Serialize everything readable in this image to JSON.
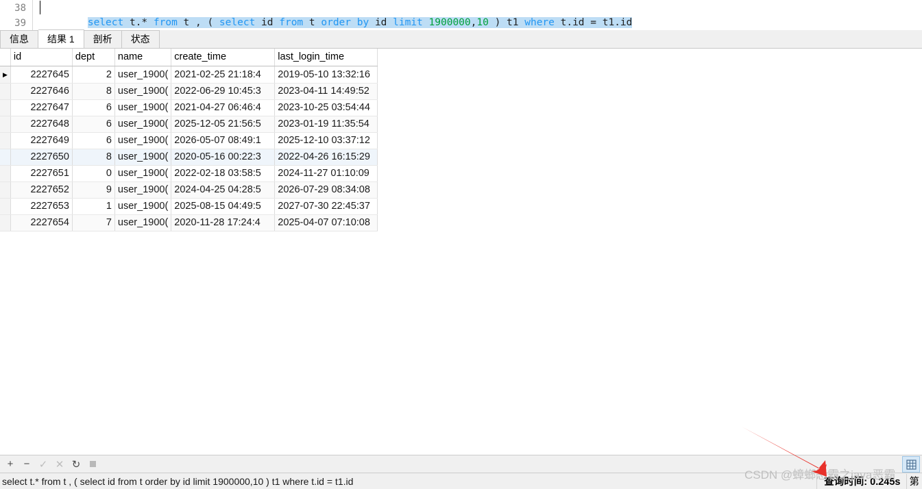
{
  "editor": {
    "line_numbers": [
      "38",
      "39"
    ],
    "sql_tokens": [
      {
        "t": "select",
        "k": "kw"
      },
      {
        "t": " t.* ",
        "k": "plain"
      },
      {
        "t": "from",
        "k": "kw"
      },
      {
        "t": " t , ( ",
        "k": "plain"
      },
      {
        "t": "select",
        "k": "kw"
      },
      {
        "t": " id ",
        "k": "plain"
      },
      {
        "t": "from",
        "k": "kw"
      },
      {
        "t": " t ",
        "k": "plain"
      },
      {
        "t": "order",
        "k": "kw"
      },
      {
        "t": " ",
        "k": "plain"
      },
      {
        "t": "by",
        "k": "kw"
      },
      {
        "t": " id ",
        "k": "plain"
      },
      {
        "t": "limit",
        "k": "kw"
      },
      {
        "t": " ",
        "k": "plain"
      },
      {
        "t": "1900000",
        "k": "num"
      },
      {
        "t": ",",
        "k": "plain"
      },
      {
        "t": "10",
        "k": "num"
      },
      {
        "t": " ) t1 ",
        "k": "plain"
      },
      {
        "t": "where",
        "k": "kw"
      },
      {
        "t": " t.id = t1.id",
        "k": "plain"
      }
    ],
    "colors": {
      "keyword": "#2196f3",
      "number": "#00a03a",
      "selection": "#bdddf5"
    }
  },
  "tabs": [
    {
      "label": "信息",
      "active": false
    },
    {
      "label": "结果 1",
      "active": true
    },
    {
      "label": "剖析",
      "active": false
    },
    {
      "label": "状态",
      "active": false
    }
  ],
  "table": {
    "columns": [
      "id",
      "dept",
      "name",
      "create_time",
      "last_login_time"
    ],
    "rows": [
      {
        "id": "2227645",
        "dept": "2",
        "name": "user_1900(",
        "create_time": "2021-02-25 21:18:4",
        "last_login_time": "2019-05-10 13:32:16",
        "current": true
      },
      {
        "id": "2227646",
        "dept": "8",
        "name": "user_1900(",
        "create_time": "2022-06-29 10:45:3",
        "last_login_time": "2023-04-11 14:49:52",
        "current": false
      },
      {
        "id": "2227647",
        "dept": "6",
        "name": "user_1900(",
        "create_time": "2021-04-27 06:46:4",
        "last_login_time": "2023-10-25 03:54:44",
        "current": false
      },
      {
        "id": "2227648",
        "dept": "6",
        "name": "user_1900(",
        "create_time": "2025-12-05 21:56:5",
        "last_login_time": "2023-01-19 11:35:54",
        "current": false
      },
      {
        "id": "2227649",
        "dept": "6",
        "name": "user_1900(",
        "create_time": "2026-05-07 08:49:1",
        "last_login_time": "2025-12-10 03:37:12",
        "current": false
      },
      {
        "id": "2227650",
        "dept": "8",
        "name": "user_1900(",
        "create_time": "2020-05-16 00:22:3",
        "last_login_time": "2022-04-26 16:15:29",
        "current": false
      },
      {
        "id": "2227651",
        "dept": "0",
        "name": "user_1900(",
        "create_time": "2022-02-18 03:58:5",
        "last_login_time": "2024-11-27 01:10:09",
        "current": false
      },
      {
        "id": "2227652",
        "dept": "9",
        "name": "user_1900(",
        "create_time": "2024-04-25 04:28:5",
        "last_login_time": "2026-07-29 08:34:08",
        "current": false
      },
      {
        "id": "2227653",
        "dept": "1",
        "name": "user_1900(",
        "create_time": "2025-08-15 04:49:5",
        "last_login_time": "2027-07-30 22:45:37",
        "current": false
      },
      {
        "id": "2227654",
        "dept": "7",
        "name": "user_1900(",
        "create_time": "2020-11-28 17:24:4",
        "last_login_time": "2025-04-07 07:10:08",
        "current": false
      }
    ]
  },
  "toolbar": {
    "add_label": "+",
    "remove_label": "−",
    "confirm_label": "✓",
    "cancel_label": "✕",
    "refresh_label": "↻",
    "stop_label": ""
  },
  "statusbar": {
    "sql_text": "select t.* from t , ( select id from t order by id limit 1900000,10 ) t1 where t.id = t1.id",
    "query_time": "查询时间: 0.245s",
    "page_label": "第"
  },
  "watermark": {
    "text": "CSDN @蟑螂恶霸之java恶霸",
    "color": "#bfbfbf"
  },
  "annotation": {
    "arrow_color": "#e8312a"
  }
}
